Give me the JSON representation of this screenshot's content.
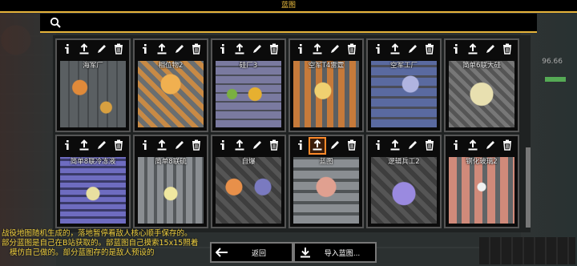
{
  "window": {
    "title": "蓝图"
  },
  "search": {
    "icon": "search-icon",
    "value": ""
  },
  "hud": {
    "right_count": "96.66"
  },
  "toolbar_icons": [
    "info-icon",
    "share-icon",
    "edit-icon",
    "delete-icon"
  ],
  "blueprints": [
    {
      "name": "海军厂",
      "preview": "pv-a"
    },
    {
      "name": "相位物2",
      "preview": "pv-b"
    },
    {
      "name": "硅厂3",
      "preview": "pv-c"
    },
    {
      "name": "空军T4雷霆",
      "preview": "pv-d"
    },
    {
      "name": "空军工厂",
      "preview": "pv-e"
    },
    {
      "name": "简单6联大硅",
      "preview": "pv-f"
    },
    {
      "name": "简单8联冷冻液",
      "preview": "pv-g"
    },
    {
      "name": "简单8联硫",
      "preview": "pv-h"
    },
    {
      "name": "自爆",
      "preview": "pv-i"
    },
    {
      "name": "蓝图",
      "preview": "pv-j",
      "active_tool": "share"
    },
    {
      "name": "逻辑兵工2",
      "preview": "pv-k"
    },
    {
      "name": "钢化玻璃2",
      "preview": "pv-l"
    }
  ],
  "footer": {
    "lines": [
      "战役地图随机生成的，落地暂停看敌人核心顺手保存的。",
      "部分蓝图是自己在B站获取的。部蓝图自己摸索15x15照着",
      "模仿自己做的。部分蓝图存的是敌人预设的"
    ]
  },
  "buttons": {
    "back": {
      "label": "返回",
      "icon": "back-arrow-icon"
    },
    "import": {
      "label": "导入蓝图...",
      "icon": "download-icon"
    }
  },
  "colors": {
    "accent": "#e6b33a",
    "active_outline": "#ff8a2a",
    "footer_text": "#f0d040"
  }
}
